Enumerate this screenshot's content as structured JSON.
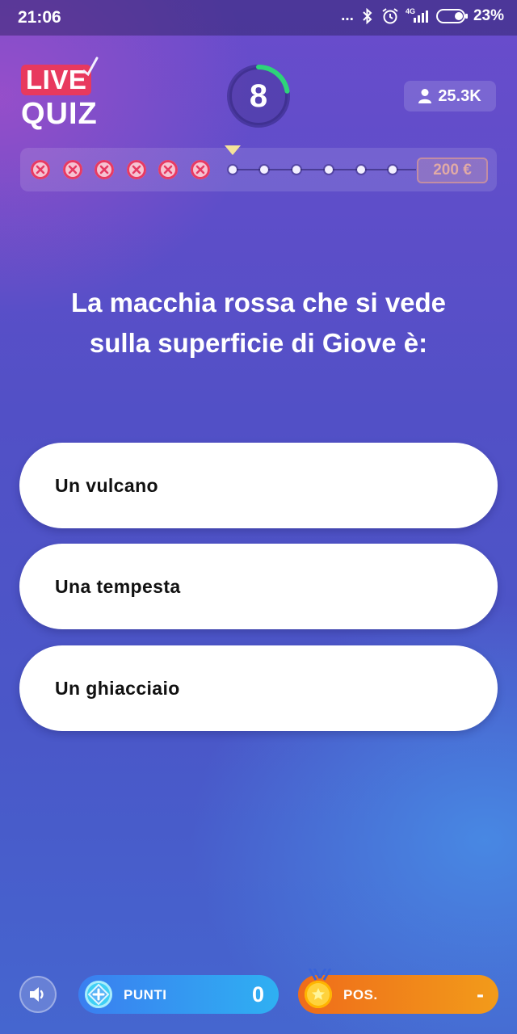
{
  "status_bar": {
    "time": "21:06",
    "dots": "...",
    "network": "4G",
    "battery": "23%"
  },
  "header": {
    "logo_top": "LIVE",
    "logo_bottom": "QUIZ",
    "timer": "8",
    "viewers": "25.3K"
  },
  "progress": {
    "wrong_answers": 6,
    "remaining_steps": 6,
    "prize": "200 €"
  },
  "question": {
    "line1": "La macchia rossa che si vede",
    "line2": "sulla superficie di Giove è:"
  },
  "answers": [
    {
      "label": "Un vulcano"
    },
    {
      "label": "Una tempesta"
    },
    {
      "label": "Un ghiacciaio"
    }
  ],
  "bottom": {
    "points_label": "PUNTI",
    "points_value": "0",
    "pos_label": "POS.",
    "pos_value": "-"
  },
  "colors": {
    "accent_red": "#e8395e",
    "timer_green": "#2ed47a",
    "points_blue": "#3a7ef0",
    "pos_orange": "#ef6c1a"
  }
}
